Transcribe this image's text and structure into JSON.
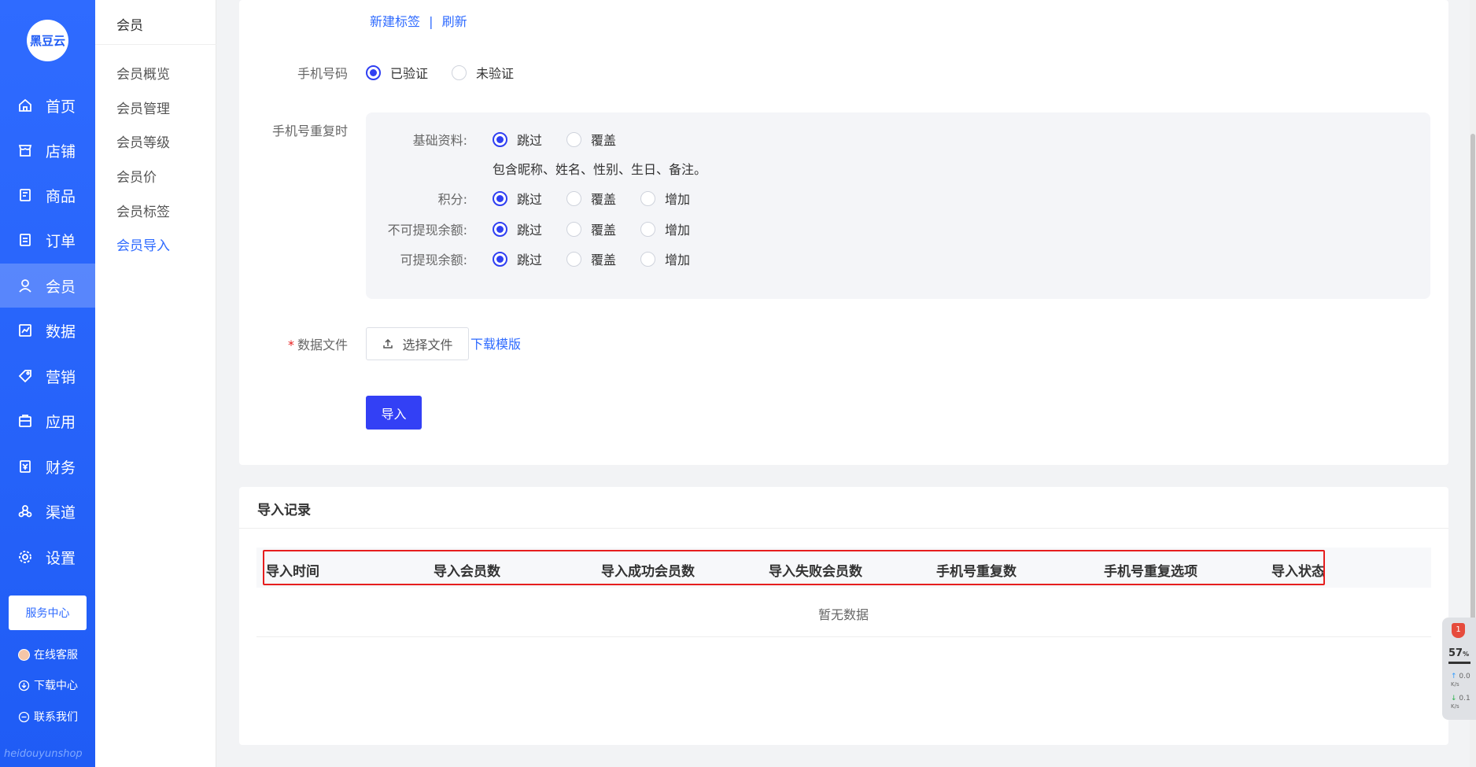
{
  "nav": {
    "logo": "黑豆云",
    "items": [
      {
        "label": "首页",
        "icon": "home-icon"
      },
      {
        "label": "店铺",
        "icon": "shop-icon"
      },
      {
        "label": "商品",
        "icon": "goods-icon"
      },
      {
        "label": "订单",
        "icon": "order-icon"
      },
      {
        "label": "会员",
        "icon": "user-icon",
        "active": true
      },
      {
        "label": "数据",
        "icon": "chart-icon"
      },
      {
        "label": "营销",
        "icon": "tag-icon"
      },
      {
        "label": "应用",
        "icon": "app-icon"
      },
      {
        "label": "财务",
        "icon": "finance-icon"
      },
      {
        "label": "渠道",
        "icon": "channel-icon"
      },
      {
        "label": "设置",
        "icon": "gear-icon"
      }
    ],
    "service_center": "服务中心",
    "links": {
      "online_service": "在线客服",
      "download_center": "下载中心",
      "contact_us": "联系我们"
    },
    "footer_brand": "heidouyunshop"
  },
  "subnav": {
    "header": "会员",
    "items": [
      "会员概览",
      "会员管理",
      "会员等级",
      "会员价",
      "会员标签",
      "会员导入"
    ],
    "active_index": 5
  },
  "form": {
    "tag_links": {
      "new_tag": "新建标签",
      "separator": "|",
      "refresh": "刷新"
    },
    "phone": {
      "label": "手机号码",
      "options": [
        "已验证",
        "未验证"
      ],
      "selected": 0
    },
    "duplicate": {
      "label": "手机号重复时",
      "basic": {
        "label": "基础资料:",
        "options": [
          "跳过",
          "覆盖"
        ],
        "selected": 0,
        "hint": "包含昵称、姓名、性别、生日、备注。"
      },
      "points": {
        "label": "积分:",
        "options": [
          "跳过",
          "覆盖",
          "增加"
        ],
        "selected": 0
      },
      "non_withdrawable": {
        "label": "不可提现余额:",
        "options": [
          "跳过",
          "覆盖",
          "增加"
        ],
        "selected": 0
      },
      "withdrawable": {
        "label": "可提现余额:",
        "options": [
          "跳过",
          "覆盖",
          "增加"
        ],
        "selected": 0
      }
    },
    "data_file": {
      "required_mark": "*",
      "label": "数据文件",
      "button": "选择文件",
      "download_template": "下载模版"
    },
    "import_button": "导入"
  },
  "records": {
    "title": "导入记录",
    "columns": [
      "导入时间",
      "导入会员数",
      "导入成功会员数",
      "导入失败会员数",
      "手机号重复数",
      "手机号重复选项",
      "导入状态"
    ],
    "empty_text": "暂无数据"
  },
  "widget": {
    "badge": "1",
    "percent": "57",
    "percent_unit": "%",
    "up": "0.0",
    "down": "0.1",
    "unit": "K/s"
  }
}
